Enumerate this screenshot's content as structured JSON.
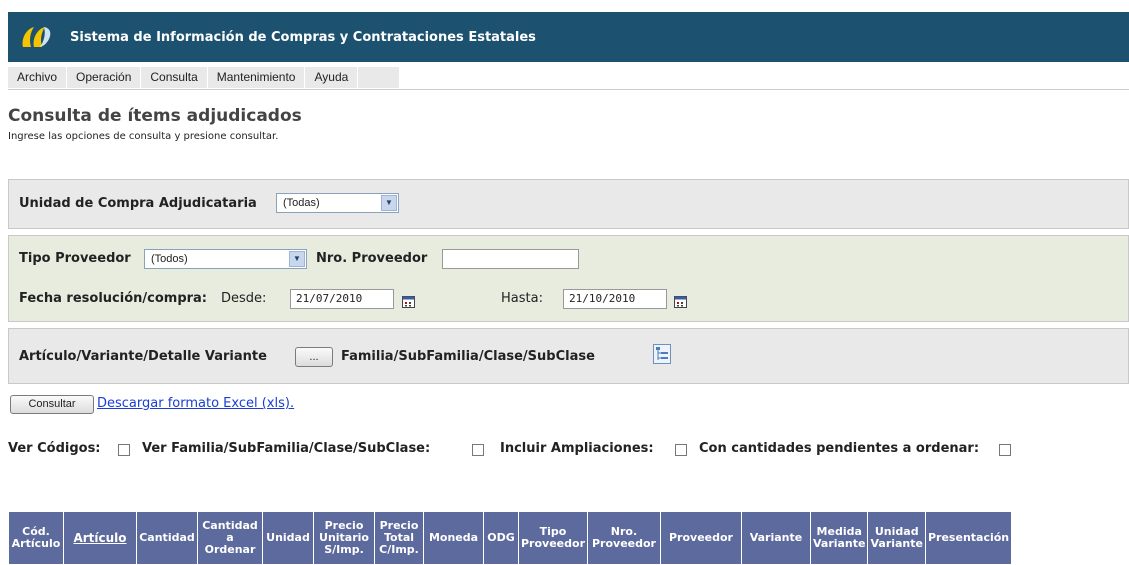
{
  "header": {
    "title": "Sistema de Información de Compras y Contrataciones Estatales",
    "brand_color": "#1c5170"
  },
  "menu": [
    "Archivo",
    "Operación",
    "Consulta",
    "Mantenimiento",
    "Ayuda"
  ],
  "page": {
    "title": "Consulta de ítems adjudicados",
    "subtitle": "Ingrese las opciones de consulta y presione consultar."
  },
  "unidad": {
    "label": "Unidad de Compra Adjudicataria",
    "value": "(Todas)"
  },
  "proveedor": {
    "tipo_label": "Tipo Proveedor",
    "tipo_value": "(Todos)",
    "nro_label": "Nro. Proveedor",
    "nro_value": ""
  },
  "fecha": {
    "label": "Fecha resolución/compra:",
    "desde_label": "Desde:",
    "desde_value": "21/07/2010",
    "hasta_label": "Hasta:",
    "hasta_value": "21/10/2010"
  },
  "articulo": {
    "label": "Artículo/Variante/Detalle Variante",
    "button": "...",
    "familia_label": "Familia/SubFamilia/Clase/SubClase"
  },
  "actions": {
    "consultar": "Consultar",
    "excel_link": "Descargar formato Excel (xls)."
  },
  "options": {
    "ver_codigos": "Ver Códigos:",
    "ver_familia": "Ver Familia/SubFamilia/Clase/SubClase:",
    "incluir_ampliaciones": "Incluir Ampliaciones:",
    "pendientes": "Con cantidades pendientes a ordenar:"
  },
  "table": {
    "header_color": "#5d6a9d",
    "columns": [
      "Cód. Artículo",
      "Artículo",
      "Cantidad",
      "Cantidad a Ordenar",
      "Unidad",
      "Precio Unitario S/Imp.",
      "Precio Total C/Imp.",
      "Moneda",
      "ODG",
      "Tipo Proveedor",
      "Nro. Proveedor",
      "Proveedor",
      "Variante",
      "Medida Variante",
      "Unidad Variante",
      "Presentación"
    ]
  }
}
